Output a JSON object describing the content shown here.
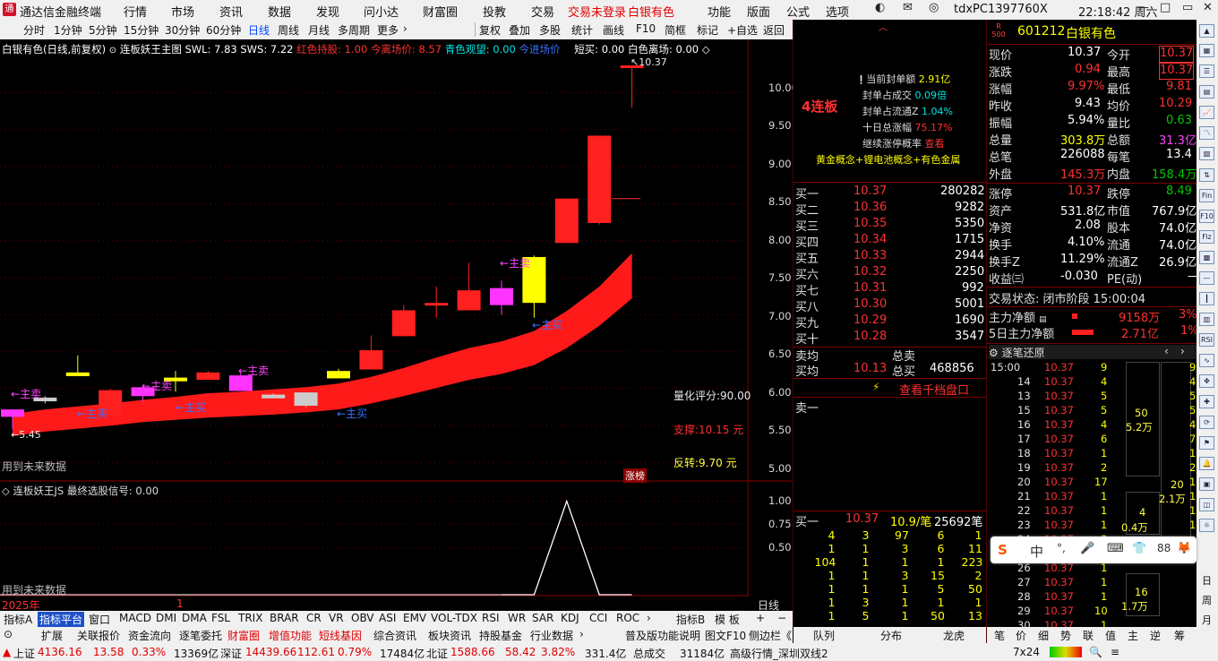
{
  "titlebar": {
    "app": "通达信金融终端",
    "menus": [
      "行情",
      "市场",
      "资讯",
      "数据",
      "发现",
      "问小达",
      "财富圈",
      "投教",
      "交易"
    ],
    "status1": "交易未登录",
    "status2": "白银有色",
    "menus_right": [
      "功能",
      "版面",
      "公式",
      "选项"
    ],
    "user": "tdxPC1397760X",
    "clock": "22:18:42 周六"
  },
  "toolbar": {
    "periods": [
      "分时",
      "1分钟",
      "5分钟",
      "15分钟",
      "30分钟",
      "60分钟",
      "日线",
      "周线",
      "月线",
      "多周期",
      "更多"
    ],
    "selected": "日线",
    "tools": [
      "复权",
      "叠加",
      "多股",
      "统计",
      "画线",
      "F10",
      "简框",
      "标记",
      "+自选",
      "返回"
    ]
  },
  "main_header": {
    "name": "白银有色(日线,前复权)",
    "formula": "连板妖王主图",
    "swl": "SWL: 7.83",
    "sws": "SWS: 7.22",
    "hold": "红色持股: 1.00",
    "today": "今离场价: 8.57",
    "watch": "青色观望: 0.00",
    "enter": "今进场价",
    "short": "短买: 0.00",
    "white": "白色离场: 0.00"
  },
  "main_axis": [
    "10.00",
    "9.50",
    "9.00",
    "8.50",
    "8.00",
    "7.50",
    "7.00",
    "6.50",
    "6.00",
    "5.50",
    "5.00"
  ],
  "annotations": {
    "high": "10.37",
    "low": "5.45",
    "score": "量化评分:90.00",
    "support": "支撑:10.15 元",
    "reverse": "反转:9.70 元",
    "future": "用到未来数据",
    "zhang": "涨榜",
    "zhumai": "主卖",
    "zhumai2": "主买"
  },
  "sub_header": {
    "name": "连板妖王JS",
    "signal": "最终选股信号: 0.00"
  },
  "sub_axis": [
    "1.00",
    "0.75",
    "0.50"
  ],
  "sub_future": "用到未来数据",
  "date_axis": {
    "year": "2025年",
    "month": "1",
    "period": "日线"
  },
  "chart_data": {
    "type": "candlestick",
    "dates": [
      "2025年",
      "1"
    ],
    "ylim": [
      4.85,
      10.6
    ],
    "candles": [
      {
        "o": 5.72,
        "c": 5.62,
        "h": 5.72,
        "l": 5.45,
        "color": "magenta"
      },
      {
        "o": 5.88,
        "c": 5.83,
        "h": 5.9,
        "l": 5.8,
        "color": "gray"
      },
      {
        "o": 6.22,
        "c": 6.17,
        "h": 6.45,
        "l": 6.17,
        "color": "yellow"
      },
      {
        "o": 5.64,
        "c": 5.98,
        "h": 6.0,
        "l": 5.64,
        "color": "red"
      },
      {
        "o": 5.9,
        "c": 6.02,
        "h": 6.02,
        "l": 5.82,
        "color": "magenta"
      },
      {
        "o": 6.1,
        "c": 6.15,
        "h": 6.24,
        "l": 5.96,
        "color": "yellow"
      },
      {
        "o": 6.12,
        "c": 6.22,
        "h": 6.24,
        "l": 6.12,
        "color": "red"
      },
      {
        "o": 5.97,
        "c": 6.18,
        "h": 6.22,
        "l": 5.97,
        "color": "magenta"
      },
      {
        "o": 5.87,
        "c": 5.92,
        "h": 5.94,
        "l": 5.87,
        "color": "gray"
      },
      {
        "o": 5.77,
        "c": 5.95,
        "h": 5.95,
        "l": 5.75,
        "color": "gray"
      },
      {
        "o": 6.14,
        "c": 6.24,
        "h": 6.27,
        "l": 6.14,
        "color": "yellow"
      },
      {
        "o": 6.26,
        "c": 6.52,
        "h": 6.72,
        "l": 6.26,
        "color": "red"
      },
      {
        "o": 6.71,
        "c": 7.06,
        "h": 7.13,
        "l": 6.71,
        "color": "red"
      },
      {
        "o": 7.16,
        "c": 7.16,
        "h": 7.38,
        "l": 6.96,
        "color": "red"
      },
      {
        "o": 7.06,
        "c": 7.33,
        "h": 7.7,
        "l": 7.06,
        "color": "red"
      },
      {
        "o": 7.13,
        "c": 7.36,
        "h": 7.46,
        "l": 7.0,
        "color": "magenta"
      },
      {
        "o": 7.16,
        "c": 7.78,
        "h": 7.8,
        "l": 6.96,
        "color": "yellow"
      },
      {
        "o": 7.97,
        "c": 8.57,
        "h": 8.57,
        "l": 7.97,
        "color": "red"
      },
      {
        "o": 8.24,
        "c": 9.42,
        "h": 9.42,
        "l": 8.22,
        "color": "red"
      },
      {
        "o": 10.37,
        "c": 10.37,
        "h": 10.37,
        "l": 9.8,
        "color": "red"
      }
    ],
    "band_upper": [
      5.66,
      5.72,
      5.76,
      5.8,
      5.85,
      5.89,
      5.94,
      5.96,
      5.99,
      6.02,
      6.07,
      6.16,
      6.28,
      6.42,
      6.55,
      6.64,
      6.78,
      7.05,
      7.38,
      7.83
    ],
    "band_lower": [
      5.36,
      5.42,
      5.46,
      5.5,
      5.55,
      5.58,
      5.61,
      5.63,
      5.65,
      5.68,
      5.72,
      5.8,
      5.9,
      6.01,
      6.12,
      6.2,
      6.32,
      6.55,
      6.85,
      7.22
    ],
    "signal": [
      0,
      0,
      0,
      0,
      0,
      0,
      0,
      0,
      0,
      0,
      0,
      0,
      0,
      0,
      0,
      0,
      0,
      1,
      0,
      0
    ],
    "sub_ylim": [
      0,
      1.1
    ]
  },
  "mid": {
    "board": "4连板",
    "stats": [
      {
        "k": "当前封单额",
        "v": "2.91亿"
      },
      {
        "k": "封单占成交",
        "v": "0.09倍"
      },
      {
        "k": "封单占流通Z",
        "v": "1.04%"
      },
      {
        "k": "十日总涨幅",
        "v": "75.17%"
      },
      {
        "k": "继续涨停概率",
        "v": "查看"
      }
    ],
    "concepts": "黄金概念+锂电池概念+有色金属",
    "bids": [
      {
        "n": "买一",
        "p": "10.37",
        "v": "280282"
      },
      {
        "n": "买二",
        "p": "10.36",
        "v": "9282"
      },
      {
        "n": "买三",
        "p": "10.35",
        "v": "5350"
      },
      {
        "n": "买四",
        "p": "10.34",
        "v": "1715"
      },
      {
        "n": "买五",
        "p": "10.33",
        "v": "2944"
      },
      {
        "n": "买六",
        "p": "10.32",
        "v": "2250"
      },
      {
        "n": "买七",
        "p": "10.31",
        "v": "992"
      },
      {
        "n": "买八",
        "p": "10.30",
        "v": "5001"
      },
      {
        "n": "买九",
        "p": "10.29",
        "v": "1690"
      },
      {
        "n": "买十",
        "p": "10.28",
        "v": "3547"
      }
    ],
    "sell_avg": "卖均",
    "sell_total": "总卖",
    "buy_avg": "买均",
    "buy_avg_v": "10.13",
    "buy_total": "总买",
    "buy_total_v": "468856",
    "thousand": "查看千档盘口",
    "ask1": "卖一",
    "queue_head": {
      "n": "买一",
      "p": "10.37",
      "avg": "10.9/笔",
      "v": "25692笔"
    },
    "queue": [
      [
        "4",
        "3",
        "97",
        "6",
        "1"
      ],
      [
        "1",
        "1",
        "3",
        "6",
        "11"
      ],
      [
        "104",
        "1",
        "1",
        "1",
        "223"
      ],
      [
        "1",
        "1",
        "3",
        "15",
        "2"
      ],
      [
        "1",
        "1",
        "1",
        "5",
        "50"
      ],
      [
        "1",
        "3",
        "1",
        "1",
        "1"
      ],
      [
        "1",
        "5",
        "1",
        "50",
        "13"
      ]
    ],
    "tabs": [
      "队列",
      "分布",
      "龙虎"
    ]
  },
  "right": {
    "code": "601212",
    "name": "白银有色",
    "rmark": "R",
    "rnum": "500",
    "quote": [
      [
        "现价",
        "10.37",
        "今开",
        "10.37"
      ],
      [
        "涨跌",
        "0.94",
        "最高",
        "10.37"
      ],
      [
        "涨幅",
        "9.97%",
        "最低",
        "9.81"
      ],
      [
        "昨收",
        "9.43",
        "均价",
        "10.29"
      ],
      [
        "振幅",
        "5.94%",
        "量比",
        "0.63"
      ],
      [
        "总量",
        "303.8万",
        "总额",
        "31.3亿"
      ],
      [
        "总笔",
        "226088",
        "每笔",
        "13.4"
      ],
      [
        "外盘",
        "145.3万",
        "内盘",
        "158.4万"
      ]
    ],
    "fund": [
      [
        "涨停",
        "10.37",
        "跌停",
        "8.49"
      ],
      [
        "资产",
        "531.8亿",
        "市值",
        "767.9亿"
      ],
      [
        "净资",
        "2.08",
        "股本",
        "74.0亿"
      ],
      [
        "换手",
        "4.10%",
        "流通",
        "74.0亿"
      ],
      [
        "换手Z",
        "11.29%",
        "流通Z",
        "26.9亿"
      ],
      [
        "收益㈢",
        "-0.030",
        "PE(动)",
        "—"
      ]
    ],
    "trade_state": "交易状态: 闭市阶段 15:00:04",
    "main_net": {
      "k": "主力净额",
      "v": "9158万",
      "p": "3%"
    },
    "net5": {
      "k": "5日主力净额",
      "v": "2.71亿",
      "p": "1%"
    },
    "ticks_title": "逐笔还原",
    "ticks": [
      [
        "15:00",
        "10.37",
        "9"
      ],
      [
        "14",
        "10.37",
        "4"
      ],
      [
        "13",
        "10.37",
        "5"
      ],
      [
        "15",
        "10.37",
        "5"
      ],
      [
        "16",
        "10.37",
        "4"
      ],
      [
        "17",
        "10.37",
        "6"
      ],
      [
        "18",
        "10.37",
        "1"
      ],
      [
        "19",
        "10.37",
        "2"
      ],
      [
        "20",
        "10.37",
        "17"
      ],
      [
        "21",
        "10.37",
        "1"
      ],
      [
        "22",
        "10.37",
        "1"
      ],
      [
        "23",
        "10.37",
        "1"
      ],
      [
        "24",
        "10.37",
        "3"
      ],
      [
        "25",
        "10.37",
        "1"
      ],
      [
        "26",
        "10.37",
        "1"
      ],
      [
        "27",
        "10.37",
        "1"
      ],
      [
        "28",
        "10.37",
        "1"
      ],
      [
        "29",
        "10.37",
        "10"
      ],
      [
        "30",
        "10.37",
        "1"
      ]
    ],
    "tick_extra": [
      "50",
      "5.2万",
      "20",
      "2.1万",
      "4",
      "0.4万",
      "16",
      "1.7万"
    ],
    "right_col": [
      "9",
      "4",
      "5",
      "5",
      "4",
      "7",
      "1",
      "2",
      "1",
      "1",
      "1",
      "1"
    ],
    "tabs": [
      "笔",
      "价",
      "细",
      "势",
      "联",
      "值",
      "主",
      "逆",
      "筹"
    ]
  },
  "bottom": {
    "tabs1": [
      "指标A",
      "指标平台",
      "窗口",
      "MACD",
      "DMI",
      "DMA",
      "FSL",
      "TRIX",
      "BRAR",
      "CR",
      "VR",
      "OBV",
      "ASI",
      "EMV",
      "VOL-TDX",
      "RSI",
      "WR",
      "SAR",
      "KDJ",
      "CCI",
      "ROC"
    ],
    "tabs1_sel": "指标平台",
    "tabs1_right": [
      "指标B",
      "模 板",
      "+",
      "−"
    ],
    "tabs2": [
      "扩展",
      "关联报价",
      "资金流向",
      "逐笔委托",
      "财富圈",
      "增值功能",
      "短线基因",
      "综合资讯",
      "板块资讯",
      "持股基金",
      "行业数据"
    ],
    "tabs2_red": [
      "财富圈",
      "增值功能",
      "短线基因"
    ],
    "tabs2_right": [
      "普及版功能说明",
      "图文F10",
      "侧边栏《"
    ]
  },
  "status": {
    "sh": "上证",
    "sh_v": "4136.16",
    "sh_c": "13.58",
    "sh_p": "0.33%",
    "sh_a": "13369亿",
    "sz": "深证",
    "sz_v": "14439.66",
    "sz_c": "112.61",
    "sz_p": "0.79%",
    "sz_a": "17484亿",
    "bz": "北证",
    "bz_v": "1588.66",
    "bz_c": "58.42",
    "bz_p": "3.82%",
    "bz_a": "331.4亿",
    "total": "总成交",
    "total_v": "31184亿",
    "hq": "高级行情_深圳双线2",
    "mode": "7x24"
  },
  "ime": {
    "logo": "S",
    "chars": [
      "中",
      "°,",
      "🎤",
      "⌨",
      "👕",
      "88",
      "🦊"
    ]
  },
  "colors": {
    "up": "#ff3030",
    "down": "#00c800",
    "yellow": "#ffff00",
    "magenta": "#ff33ff",
    "band": "#ff1a1a",
    "label": "#e0e0e0"
  }
}
